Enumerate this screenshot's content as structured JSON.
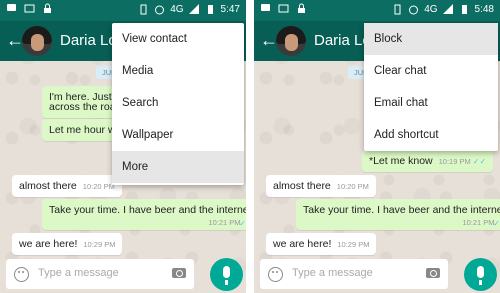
{
  "status": {
    "network": "4G",
    "time_left": "5:47",
    "time_right": "5:48"
  },
  "appbar": {
    "back_glyph": "←",
    "contact_name": "Daria Lomb"
  },
  "chat": {
    "date_chip": "JUN",
    "left_msgs": [
      {
        "text": "I'm here. Just dr",
        "dir": "out"
      },
      {
        "text": "across the road",
        "dir": "out"
      },
      {
        "text": "Let me hour wh",
        "dir": "out"
      }
    ],
    "right_msgs": [
      {
        "text": "*Let me know",
        "time": "10:19 PM",
        "dir": "out"
      }
    ],
    "common_msgs": [
      {
        "text": "almost there",
        "time": "10:20 PM",
        "dir": "in"
      },
      {
        "text": "Take your time. I have beer and the internet",
        "time": "10:21 PM",
        "dir": "out"
      },
      {
        "text": "we are here!",
        "time": "10:29 PM",
        "dir": "in"
      }
    ]
  },
  "input": {
    "placeholder": "Type a message"
  },
  "menu_left": [
    "View contact",
    "Media",
    "Search",
    "Wallpaper",
    "More"
  ],
  "menu_right": [
    "Block",
    "Clear chat",
    "Email chat",
    "Add shortcut"
  ],
  "icons": {
    "emoji": "emoji-icon",
    "camera": "camera-icon",
    "mic": "mic-icon",
    "back": "back-arrow-icon"
  },
  "colors": {
    "appbar": "#075e54",
    "statusbar": "#0c6e63",
    "outgoing": "#dcf8c6",
    "fab": "#00a896"
  }
}
